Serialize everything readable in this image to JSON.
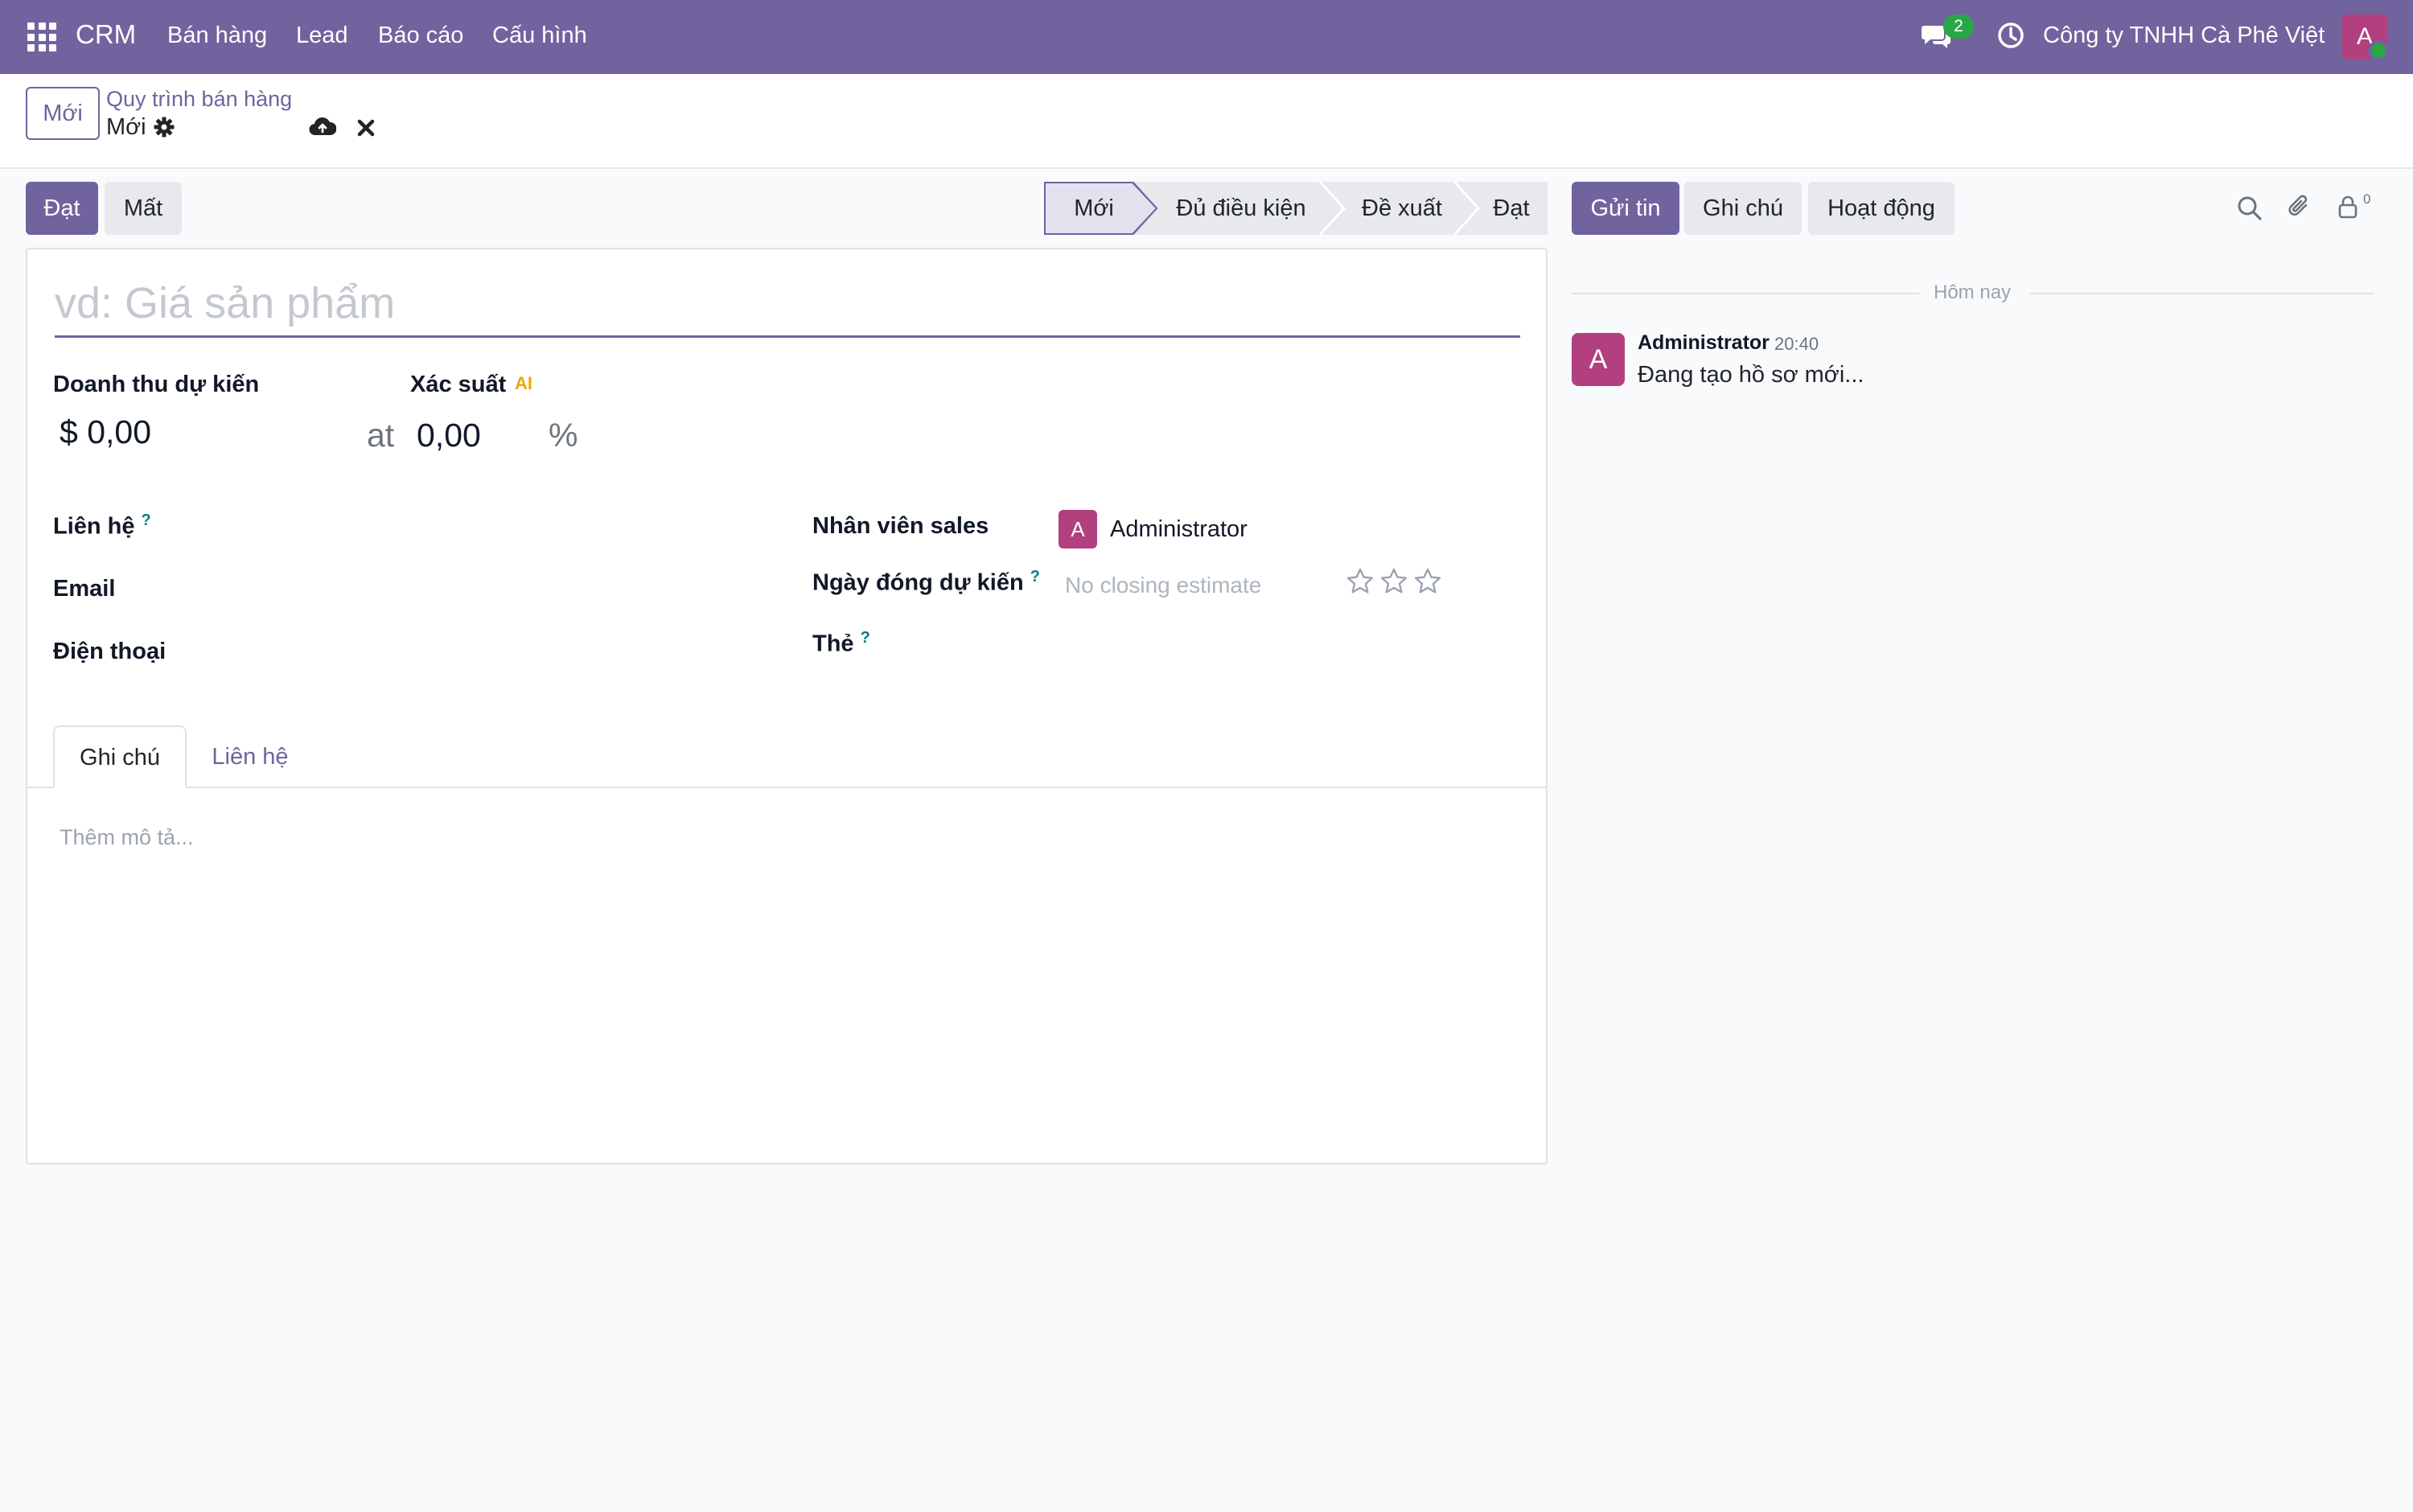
{
  "navbar": {
    "brand": "CRM",
    "menu": [
      "Bán hàng",
      "Lead",
      "Báo cáo",
      "Cấu hình"
    ],
    "message_count": "2",
    "company": "Công ty TNHH Cà Phê Việt",
    "user_initial": "A"
  },
  "control_panel": {
    "new_button": "Mới",
    "breadcrumb": "Quy trình bán hàng",
    "record_name": "Mới"
  },
  "status_buttons": {
    "won": "Đạt",
    "lost": "Mất"
  },
  "stages": [
    "Mới",
    "Đủ điều kiện",
    "Đề xuất",
    "Đạt"
  ],
  "active_stage": "Mới",
  "form": {
    "title_placeholder": "vd: Giá sản phẩm",
    "expected_revenue_label": "Doanh thu dự kiến",
    "expected_revenue_value": "$ 0,00",
    "at_label": "at",
    "probability_label": "Xác suất",
    "ai_badge": "AI",
    "probability_value": "0,00",
    "percent": "%",
    "contact_label": "Liên hệ",
    "email_label": "Email",
    "phone_label": "Điện thoại",
    "salesperson_label": "Nhân viên sales",
    "salesperson_initial": "A",
    "salesperson_name": "Administrator",
    "deadline_label": "Ngày đóng dự kiến",
    "deadline_placeholder": "No closing estimate",
    "tags_label": "Thẻ",
    "help_mark": "?",
    "priority_stars": 0
  },
  "tabs": {
    "notes": "Ghi chú",
    "contact": "Liên hệ"
  },
  "description_placeholder": "Thêm mô tả...",
  "chatter": {
    "send_message": "Gửi tin",
    "log_note": "Ghi chú",
    "activities": "Hoạt động",
    "follower_count": "0",
    "date_separator": "Hôm nay",
    "messages": [
      {
        "author_initial": "A",
        "author": "Administrator",
        "time": "20:40",
        "body": "Đang tạo hồ sơ mới..."
      }
    ]
  },
  "colors": {
    "brand": "#71639e",
    "avatar": "#b2407e",
    "online": "#28a745",
    "help": "#017e84"
  }
}
